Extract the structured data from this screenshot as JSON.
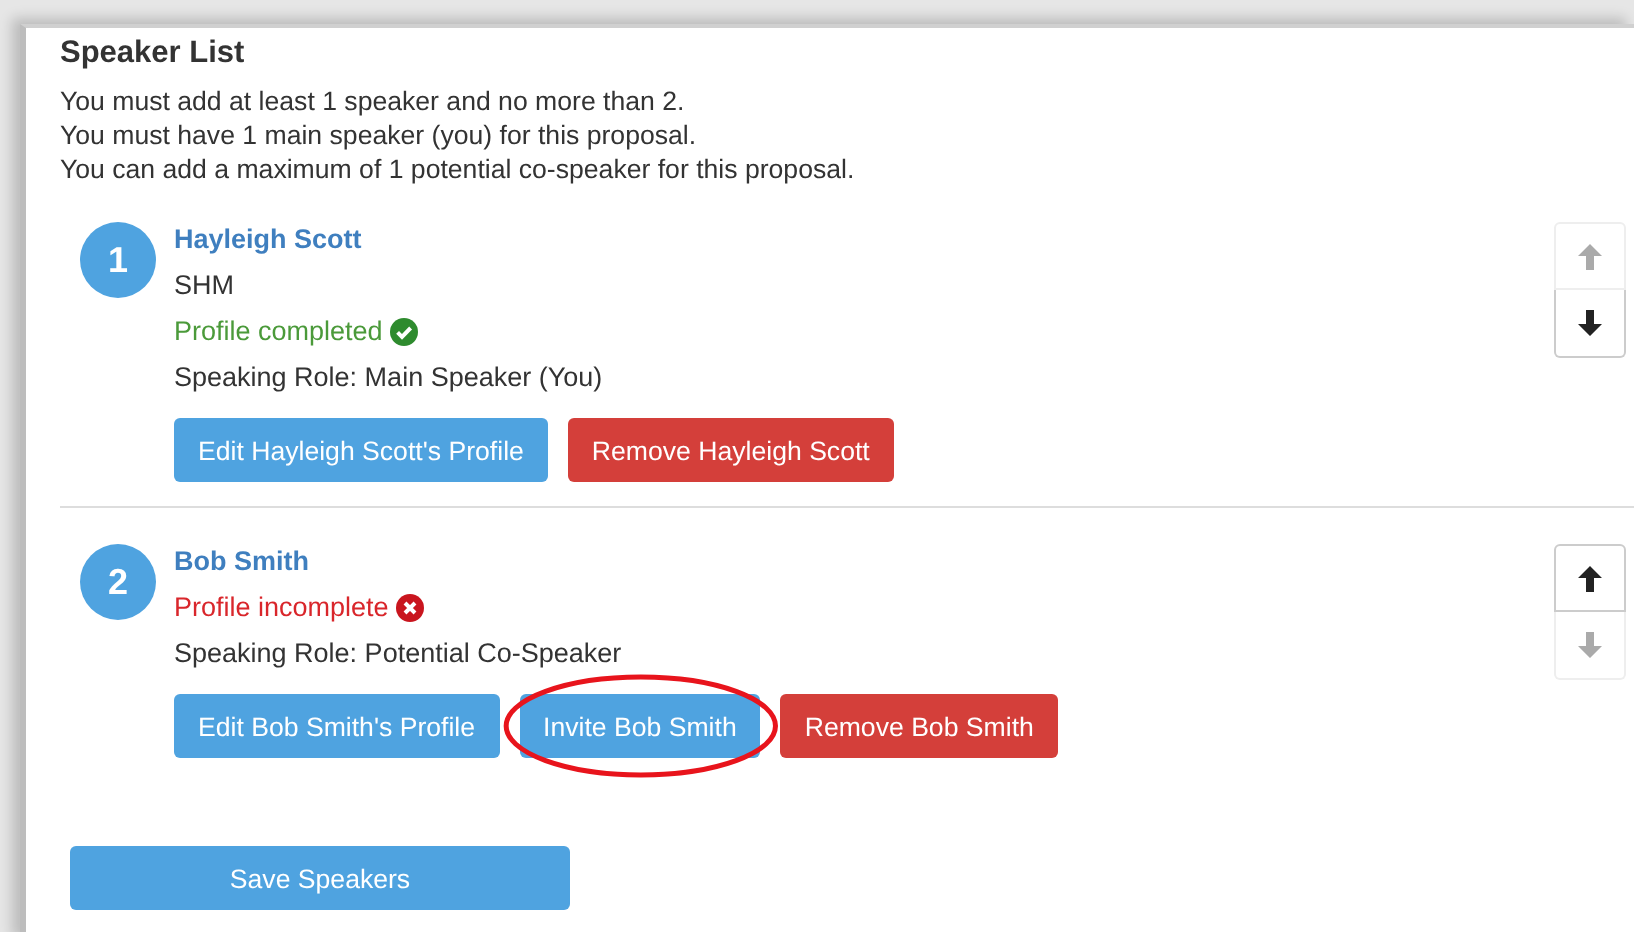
{
  "title": "Speaker List",
  "instructions": [
    "You must add at least 1 speaker and no more than 2.",
    "You must have 1 main speaker (you) for this proposal.",
    "You can add a maximum of 1 potential co-speaker for this proposal."
  ],
  "speakers": [
    {
      "number": "1",
      "name": "Hayleigh Scott",
      "organization": "SHM",
      "profile_status": {
        "kind": "complete",
        "text": "Profile completed"
      },
      "role": "Speaking Role: Main Speaker (You)",
      "buttons": [
        {
          "kind": "edit",
          "label": "Edit Hayleigh Scott's Profile",
          "highlighted": false
        },
        {
          "kind": "remove",
          "label": "Remove Hayleigh Scott",
          "highlighted": false
        }
      ],
      "move_up_disabled": true,
      "move_down_disabled": false
    },
    {
      "number": "2",
      "name": "Bob Smith",
      "profile_status": {
        "kind": "incomplete",
        "text": "Profile incomplete"
      },
      "role": "Speaking Role: Potential Co-Speaker",
      "buttons": [
        {
          "kind": "edit",
          "label": "Edit Bob Smith's Profile",
          "highlighted": false
        },
        {
          "kind": "invite",
          "label": "Invite Bob Smith",
          "highlighted": true
        },
        {
          "kind": "remove",
          "label": "Remove Bob Smith",
          "highlighted": false
        }
      ],
      "move_up_disabled": false,
      "move_down_disabled": true
    }
  ],
  "save_button": "Save Speakers"
}
